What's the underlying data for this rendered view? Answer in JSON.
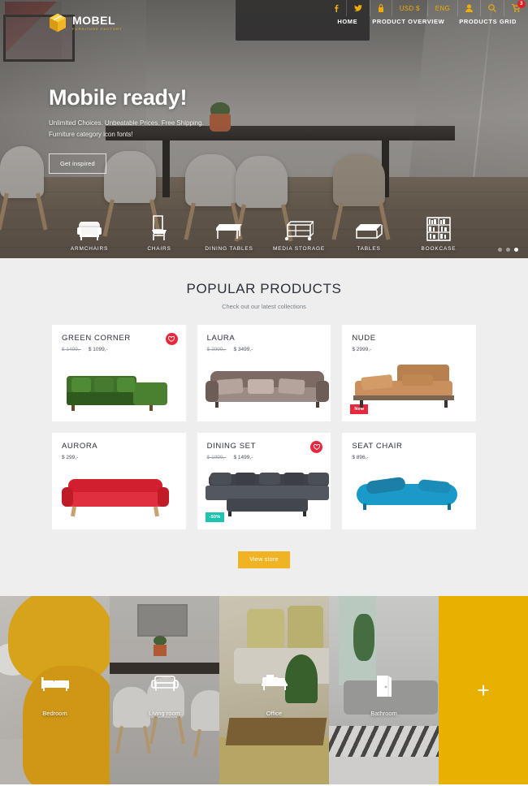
{
  "topbar": {
    "items": [
      {
        "name": "facebook-icon",
        "label": "f"
      },
      {
        "name": "twitter-icon",
        "label": ""
      },
      {
        "name": "lock-icon",
        "label": ""
      },
      {
        "name": "currency-selector",
        "label": "USD $"
      },
      {
        "name": "language-selector",
        "label": "ENG"
      },
      {
        "name": "account-icon",
        "label": ""
      },
      {
        "name": "search-icon",
        "label": ""
      },
      {
        "name": "cart-icon",
        "label": ""
      }
    ],
    "cart_count": "3"
  },
  "brand": {
    "name": "MOBEL",
    "tagline": "FURNITURE FACTORY",
    "accent_color": "#f0b323"
  },
  "nav": {
    "items": [
      {
        "label": "HOME"
      },
      {
        "label": "PRODUCT OVERVIEW"
      },
      {
        "label": "PRODUCTS GRID"
      }
    ]
  },
  "hero": {
    "title": "Mobile ready!",
    "subtitle_line1": "Unlimited Choices. Unbeatable Prices. Free Shipping.",
    "subtitle_line2": "Furniture category icon fonts!",
    "cta_label": "Get inspired",
    "slider_dots": 3,
    "active_dot": 3
  },
  "categories": [
    {
      "label": "ARMCHAIRS",
      "icon": "armchair-icon"
    },
    {
      "label": "CHAIRS",
      "icon": "chair-icon"
    },
    {
      "label": "DINING TABLES",
      "icon": "dining-table-icon"
    },
    {
      "label": "MEDIA STORAGE",
      "icon": "media-storage-icon"
    },
    {
      "label": "TABLES",
      "icon": "table-icon"
    },
    {
      "label": "BOOKCASE",
      "icon": "bookcase-icon"
    }
  ],
  "popular": {
    "title": "POPULAR PRODUCTS",
    "subtitle": "Check out our latest collections",
    "view_store_label": "View store",
    "products": [
      {
        "name": "GREEN CORNER",
        "price_old": "$ 1499,-",
        "price_now": "$ 1099,-",
        "wishlist": true,
        "badge": "",
        "badge_type": "",
        "color": "#3c6b2a"
      },
      {
        "name": "LAURA",
        "price_old": "$ 3999,-",
        "price_now": "$ 3499,-",
        "wishlist": false,
        "badge": "",
        "badge_type": "",
        "color": "#9e8b84"
      },
      {
        "name": "NUDE",
        "price_old": "",
        "price_now": "$ 2999,-",
        "wishlist": false,
        "badge": "New",
        "badge_type": "new",
        "color": "#c08553"
      },
      {
        "name": "AURORA",
        "price_old": "",
        "price_now": "$ 299,-",
        "wishlist": false,
        "badge": "",
        "badge_type": "",
        "color": "#d8202f"
      },
      {
        "name": "DINING SET",
        "price_old": "$ 1999,-",
        "price_now": "$ 1499,-",
        "wishlist": true,
        "badge": "-50%",
        "badge_type": "sale",
        "color": "#4a4d52"
      },
      {
        "name": "SEAT CHAIR",
        "price_old": "",
        "price_now": "$ 896,-",
        "wishlist": false,
        "badge": "",
        "badge_type": "",
        "color": "#1899c4"
      }
    ]
  },
  "rooms": {
    "items": [
      {
        "label": "Bedroom",
        "icon": "bed-icon"
      },
      {
        "label": "Living room",
        "icon": "sofa-icon"
      },
      {
        "label": "Office",
        "icon": "desk-icon"
      },
      {
        "label": "Bathroom",
        "icon": "shower-door-icon"
      }
    ],
    "more_label": "+"
  },
  "colors": {
    "accent": "#f0b323",
    "red": "#e8283c",
    "teal": "#1ec4b0",
    "dark": "#2c3038"
  }
}
